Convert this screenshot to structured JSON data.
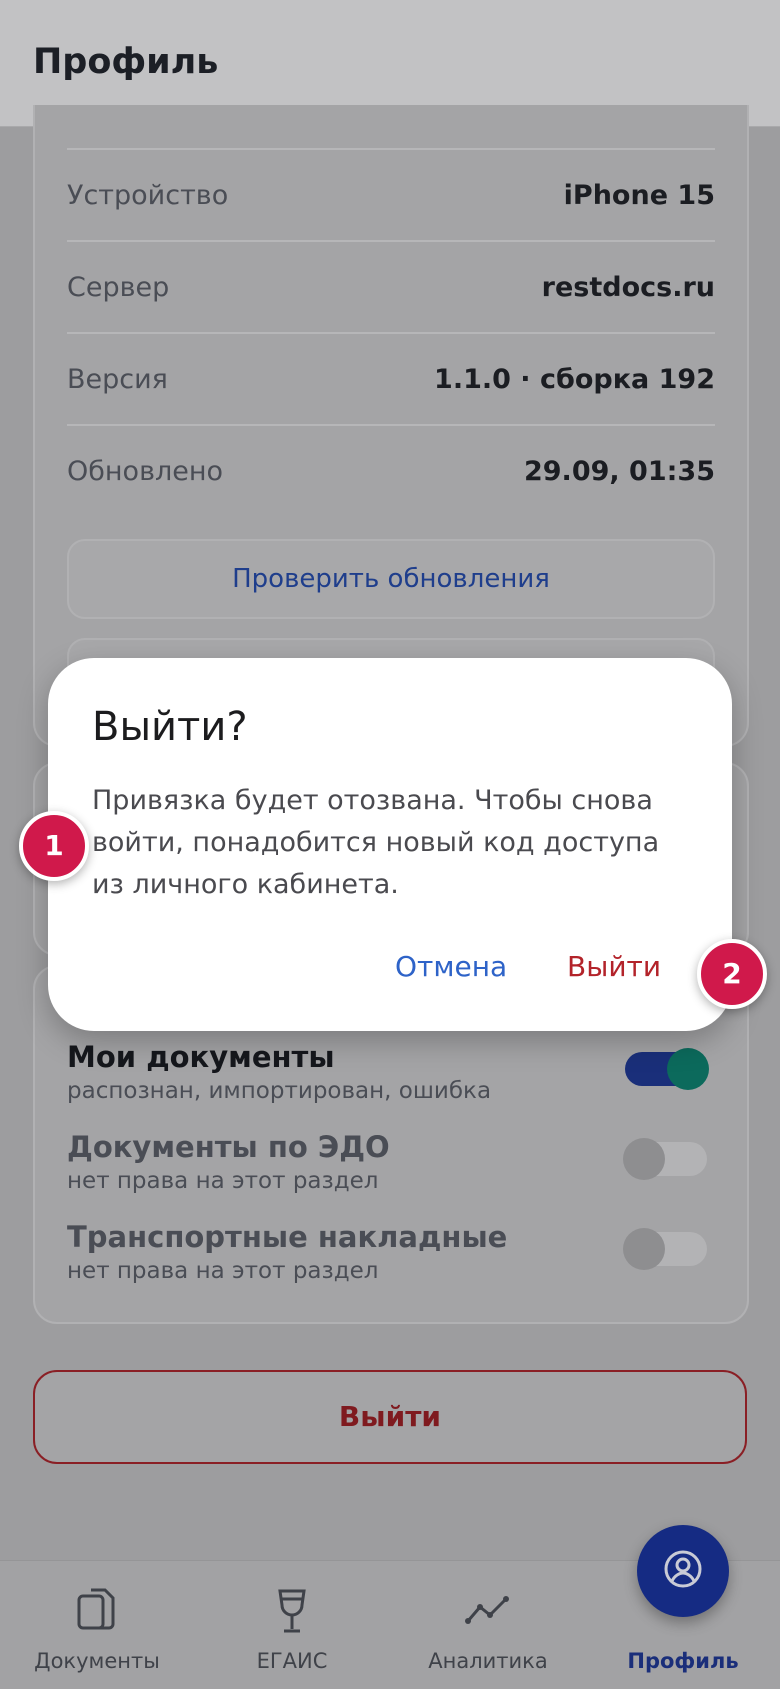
{
  "header": {
    "title": "Профиль"
  },
  "info": {
    "rows": [
      {
        "label": "Устройство",
        "value": "iPhone 15"
      },
      {
        "label": "Сервер",
        "value": "restdocs.ru"
      },
      {
        "label": "Версия",
        "value": "1.1.0 · сборка 192"
      },
      {
        "label": "Обновлено",
        "value": "29.09, 01:35"
      }
    ],
    "check_updates": "Проверить обновления"
  },
  "docs": {
    "items": [
      {
        "title": "Мои документы",
        "subtitle": "распознан, импортирован, ошибка",
        "enabled": true
      },
      {
        "title": "Документы по ЭДО",
        "subtitle": "нет права на этот раздел",
        "enabled": false
      },
      {
        "title": "Транспортные накладные",
        "subtitle": "нет права на этот раздел",
        "enabled": false
      }
    ]
  },
  "logout_button": "Выйти",
  "tabbar": {
    "tabs": [
      {
        "label": "Документы",
        "icon": "documents-icon"
      },
      {
        "label": "ЕГАИС",
        "icon": "wine-glass-icon"
      },
      {
        "label": "Аналитика",
        "icon": "chart-line-icon"
      },
      {
        "label": "Профиль",
        "icon": "profile-icon",
        "active": true
      }
    ]
  },
  "dialog": {
    "title": "Выйти?",
    "body": "Привязка будет отозвана. Чтобы снова войти, понадобится новый код доступа из личного кабинета.",
    "cancel": "Отмена",
    "confirm": "Выйти"
  },
  "annotations": {
    "badge1": "1",
    "badge2": "2"
  },
  "colors": {
    "accent": "#152b83",
    "danger": "#b3232a",
    "link": "#2e63c8",
    "badge": "#d0194b"
  }
}
